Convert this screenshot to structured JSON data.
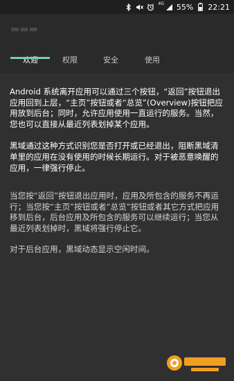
{
  "status_bar": {
    "battery": "55%",
    "time": "22:21",
    "network": "4G",
    "icons": [
      "bluetooth-icon",
      "mute-icon",
      "alarm-icon",
      "signal-icon",
      "battery-icon"
    ]
  },
  "tabs": [
    {
      "label": "欢迎",
      "active": true
    },
    {
      "label": "权限",
      "active": false
    },
    {
      "label": "安全",
      "active": false
    },
    {
      "label": "使用",
      "active": false
    }
  ],
  "content": {
    "paragraphs": [
      "Android 系统离开应用可以通过三个按钮，“返回”按钮退出应用回到上层，“主页”按钮或者“总览”(Overview)按钮把应用放到后台；同时，允许应用使用一直运行的服务。当然，您也可以直接从最近列表划掉某个应用。",
      "黑域通过这种方式识别您是否打开或已经退出，阻断黑域清单里的应用在没有使用的时候长期运行。对于被恶意唤醒的应用，一律强行停止。",
      "当您按“返回”按钮退出应用时，应用及所包含的服务不再运行；当您按“主页”按钮或者“总览”按钮或者其它方式把应用移到后台，后台应用及所包含的服务可以继续运行；当您从最近列表划掉时，黑域将强行停止它。",
      "对于后台应用，黑域动态显示空闲时间。"
    ]
  },
  "colors": {
    "accent": "#79ccb8",
    "background": "#303030",
    "header": "#2a2a2a",
    "status_bar": "#1f1f1f"
  }
}
